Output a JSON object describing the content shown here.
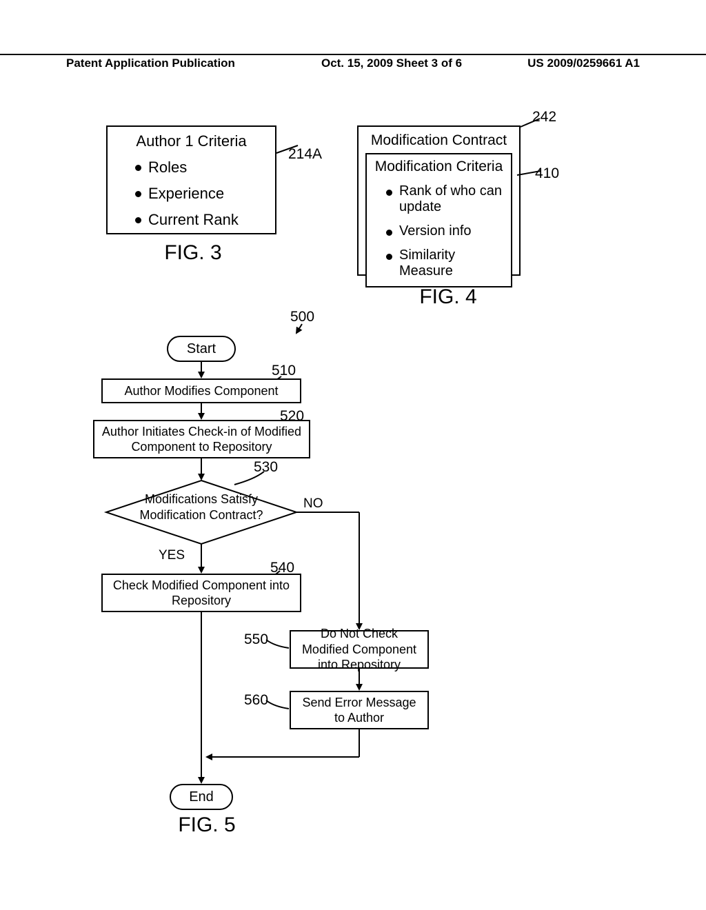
{
  "header": {
    "left": "Patent Application Publication",
    "mid": "Oct. 15, 2009  Sheet 3 of 6",
    "right": "US 2009/0259661 A1"
  },
  "fig3": {
    "title": "Author 1 Criteria",
    "bullets": [
      "Roles",
      "Experience",
      "Current Rank"
    ],
    "ref": "214A",
    "label": "FIG. 3"
  },
  "fig4": {
    "title": "Modification Contract",
    "subtitle": "Modification Criteria",
    "bullets": [
      "Rank of who can update",
      "Version info",
      "Similarity Measure"
    ],
    "ref_outer": "242",
    "ref_inner": "410",
    "label": "FIG. 4"
  },
  "fig5": {
    "label": "FIG. 5",
    "ref": "500",
    "start": "Start",
    "end": "End",
    "step510": {
      "ref": "510",
      "text": "Author Modifies Component"
    },
    "step520": {
      "ref": "520",
      "text": "Author Initiates Check-in of Modified Component to Repository"
    },
    "dec530": {
      "ref": "530",
      "text": "Modifications Satisfy Modification Contract?",
      "yes": "YES",
      "no": "NO"
    },
    "step540": {
      "ref": "540",
      "text": "Check Modified Component into Repository"
    },
    "step550": {
      "ref": "550",
      "text": "Do Not Check Modified Component into Repository"
    },
    "step560": {
      "ref": "560",
      "text": "Send Error Message to Author"
    }
  }
}
